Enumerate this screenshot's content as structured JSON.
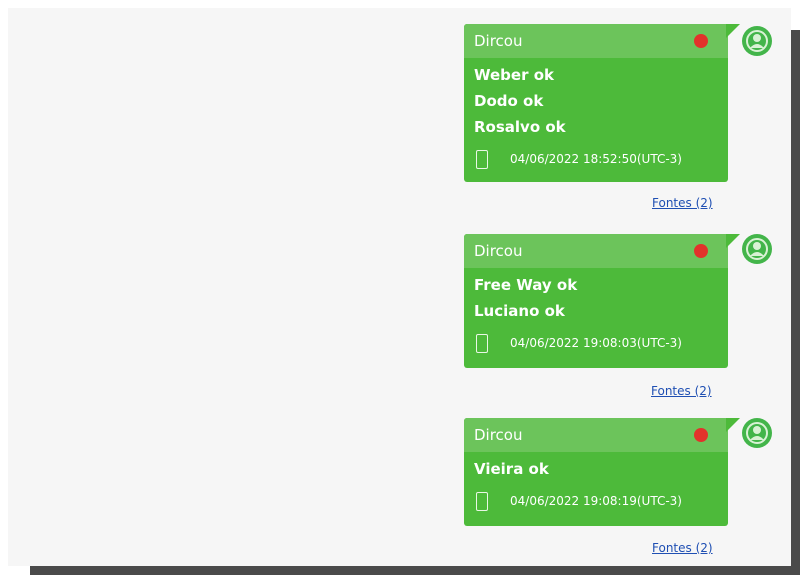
{
  "messages": [
    {
      "sender": "Dircou",
      "lines": [
        "Weber ok",
        "Dodo ok",
        "Rosalvo ok"
      ],
      "timestamp": "04/06/2022 18:52:50(UTC-3)",
      "sources_link": "Fontes (2)"
    },
    {
      "sender": "Dircou",
      "lines": [
        "Free Way ok",
        "Luciano ok"
      ],
      "timestamp": "04/06/2022 19:08:03(UTC-3)",
      "sources_link": "Fontes (2)"
    },
    {
      "sender": "Dircou",
      "lines": [
        "Vieira ok"
      ],
      "timestamp": "04/06/2022 19:08:19(UTC-3)",
      "sources_link": "Fontes (2)"
    }
  ],
  "colors": {
    "bubble": "#4dba3a",
    "header": "#6cc45b",
    "status_dot": "#e2322b",
    "link": "#1f4fb3"
  },
  "icons": {
    "avatar": "user-avatar-icon",
    "device": "phone-icon",
    "status": "red-dot-icon"
  }
}
